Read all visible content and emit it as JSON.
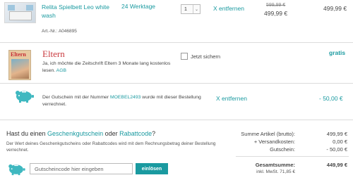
{
  "cart": {
    "item": {
      "name": "Relita Spielbett Leo white wash",
      "article_no": "Art.-Nr.: A046895",
      "delivery": "24 Werktage",
      "quantity": "1",
      "remove_label": "X entfernen",
      "old_price": "599,99 €",
      "new_price": "499,99 €",
      "row_price": "499,99 €"
    },
    "magazine": {
      "cover_title": "Eltern",
      "title": "Eltern",
      "text": "Ja, ich möchte die Zeitschrift Eltern 3 Monate lang kostenlos lesen.",
      "agb_link": "AGB",
      "checkbox_label": "Jetzt sichern",
      "checked": false,
      "price": "gratis"
    },
    "voucher_row": {
      "text_before": "Der Gutschein mit der Nummer ",
      "code": "MOEBEL2493",
      "text_after": " wurde mit dieser Bestellung verrechnet.",
      "remove_label": "X entfernen",
      "discount": "- 50,00 €"
    }
  },
  "voucher_box": {
    "title_prefix": "Hast du einen ",
    "title_link1": "Geschenkgutschein",
    "title_mid": " oder ",
    "title_link2": "Rabattcode",
    "title_suffix": "?",
    "description": "Der Wert deines Geschenkgutscheins oder Rabattcodes wird mit dem Rechnungsbetrag deiner Bestellung verrechnet.",
    "input_placeholder": "Gutscheincode hier eingeben",
    "button_label": "einlösen"
  },
  "summary": {
    "subtotal_label": "Summe Artikel (brutto):",
    "subtotal": "499,99 €",
    "shipping_label": "+ Versandkosten:",
    "shipping": "0,00 €",
    "voucher_label": "Gutschein:",
    "voucher": "- 50,00 €",
    "total_label": "Gesamtsumme:",
    "total": "449,99 €",
    "vat_note": "inkl. MwSt. 71,85 €"
  },
  "colors": {
    "accent": "#1a9aa0",
    "brand_red": "#c93a3f"
  },
  "icons": {
    "piggy": "piggy-bank-icon",
    "dropdown": "chevron-down-icon"
  }
}
